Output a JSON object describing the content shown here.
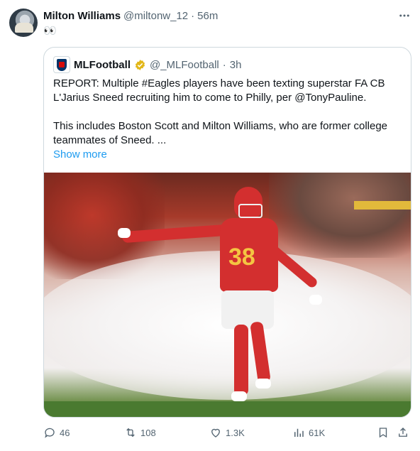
{
  "tweet": {
    "author_name": "Milton Williams",
    "handle": "@miltonw_12",
    "separator": "·",
    "time": "56m",
    "text": "👀",
    "more_icon": "more-horizontal-icon"
  },
  "quote": {
    "author_name": "MLFootball",
    "handle": "@_MLFootball",
    "separator": "·",
    "time": "3h",
    "verified": true,
    "verified_color": "#e2b719",
    "paragraph1_line1": "REPORT: Multiple #Eagles players have been texting superstar FA CB",
    "paragraph1_line2": "L'Jarius Sneed recruiting him to come to Philly, per @TonyPauline.",
    "paragraph2_line1": "This includes Boston Scott and Milton Williams, who are former college",
    "paragraph2_line2": "teammates of Sneed. ...",
    "show_more": "Show more",
    "media": {
      "jersey_number": "38"
    }
  },
  "actions": {
    "replies": "46",
    "reposts": "108",
    "likes": "1.3K",
    "views": "61K"
  },
  "colors": {
    "link": "#1d9bf0",
    "muted": "#536471",
    "text": "#0f1419"
  }
}
